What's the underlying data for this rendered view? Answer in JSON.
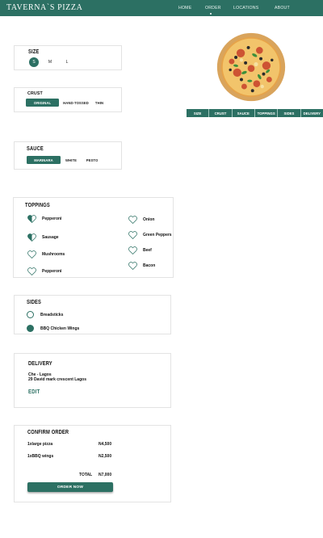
{
  "nav": {
    "brand": "TAVERNA`S PIZZA",
    "links": [
      "HOME",
      "ORDER",
      "LOCATIONS",
      "ABOUT"
    ],
    "active": "ORDER"
  },
  "size": {
    "title": "SIZE",
    "options": [
      "S",
      "M",
      "L"
    ],
    "selected": "S"
  },
  "crust": {
    "title": "CRUST",
    "options": [
      "ORIGINAL",
      "HAND-TOSSED",
      "THIN"
    ],
    "selected": "ORIGINAL"
  },
  "sauce": {
    "title": "SAUCE",
    "options": [
      "MARINARA",
      "WHITE",
      "PESTO"
    ],
    "selected": "MARINARA"
  },
  "tabs": [
    "SIZE",
    "CRUST",
    "SAUCE",
    "TOPPINGS",
    "SIDES",
    "DELIVERY"
  ],
  "toppings": {
    "title": "TOPPINGS",
    "left": [
      {
        "label": "Pepperoni",
        "state": "half"
      },
      {
        "label": "Sausage",
        "state": "half"
      },
      {
        "label": "Mushrooms",
        "state": "empty"
      },
      {
        "label": "Pepperoni",
        "state": "empty"
      }
    ],
    "right": [
      {
        "label": "Onion",
        "state": "empty"
      },
      {
        "label": "Green Peppers",
        "state": "empty"
      },
      {
        "label": "Beef",
        "state": "empty"
      },
      {
        "label": "Bacon",
        "state": "empty"
      }
    ]
  },
  "sides": {
    "title": "SIDES",
    "items": [
      {
        "label": "Breadsticks",
        "selected": false
      },
      {
        "label": "BBQ Chicken Wings",
        "selected": true
      }
    ]
  },
  "delivery": {
    "title": "DELIVERY",
    "name": "Che - Lagos",
    "address": "29 David mark crescent Lagos",
    "edit_label": "EDIT"
  },
  "confirm": {
    "title": "CONFIRM ORDER",
    "lines": [
      {
        "item": "1xlarge pizza",
        "price": "N4,500"
      },
      {
        "item": "1xBBQ wings",
        "price": "N2,500"
      }
    ],
    "total_label": "TOTAL",
    "total_value": "N7,000",
    "button_label": "ORDER NOW"
  },
  "colors": {
    "accent": "#2c7063"
  }
}
